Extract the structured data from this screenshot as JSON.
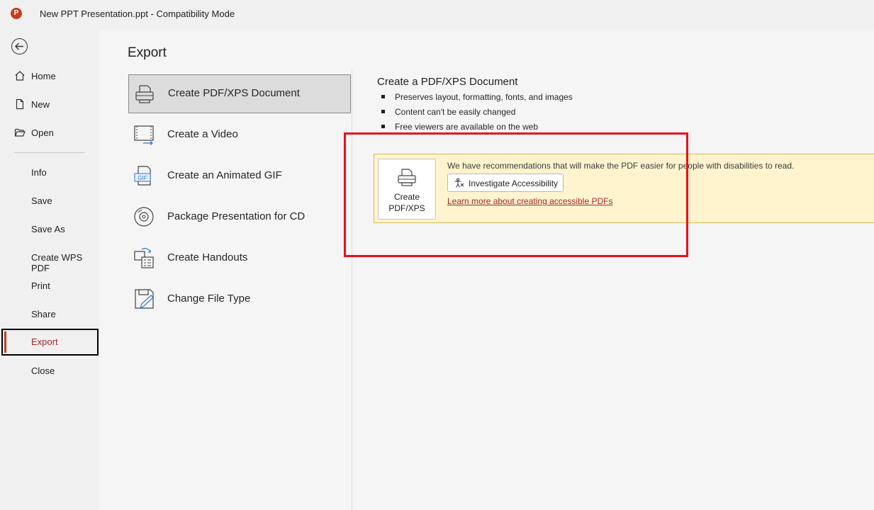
{
  "window": {
    "app_logo_letter": "P",
    "title": "New PPT Presentation.ppt  -  Compatibility Mode"
  },
  "nav": {
    "items": [
      {
        "label": "Home",
        "icon": "home-icon"
      },
      {
        "label": "New",
        "icon": "new-document-icon"
      },
      {
        "label": "Open",
        "icon": "open-folder-icon"
      },
      {
        "label": "Info"
      },
      {
        "label": "Save"
      },
      {
        "label": "Save As"
      },
      {
        "label": "Create WPS PDF"
      },
      {
        "label": "Print"
      },
      {
        "label": "Share"
      },
      {
        "label": "Export",
        "active": true
      },
      {
        "label": "Close"
      }
    ]
  },
  "export": {
    "title": "Export",
    "options": [
      {
        "label": "Create PDF/XPS Document",
        "icon": "pdf-printer-icon",
        "selected": true
      },
      {
        "label": "Create a Video",
        "icon": "video-icon"
      },
      {
        "label": "Create an Animated GIF",
        "icon": "gif-icon",
        "icon_text": "GIF"
      },
      {
        "label": "Package Presentation for CD",
        "icon": "cd-icon"
      },
      {
        "label": "Create Handouts",
        "icon": "handouts-icon"
      },
      {
        "label": "Change File Type",
        "icon": "change-file-type-icon"
      }
    ],
    "detail": {
      "title": "Create a PDF/XPS Document",
      "bullets": [
        "Preserves layout, formatting, fonts, and images",
        "Content can't be easily changed",
        "Free viewers are available on the web"
      ],
      "button_label_line1": "Create",
      "button_label_line2": "PDF/XPS",
      "banner_message": "We have recommendations that will make the PDF easier for people with disabilities to read.",
      "investigate_label": "Investigate Accessibility",
      "learn_more_link": "Learn more about creating accessible PDFs"
    }
  },
  "colors": {
    "accent": "#c43e1c",
    "active_text": "#a4262c",
    "banner_bg": "#fff4ce",
    "highlight": "#e8101b"
  }
}
